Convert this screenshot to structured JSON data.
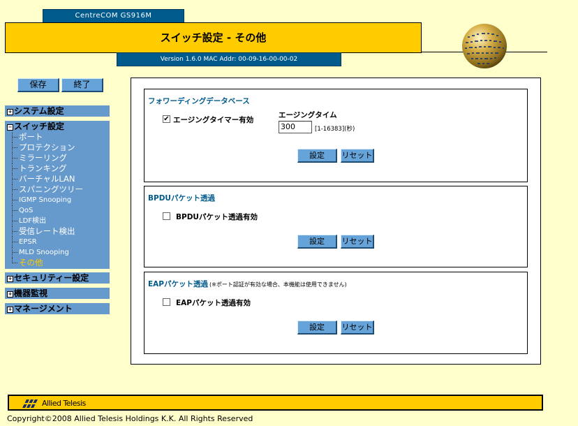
{
  "header": {
    "product": "CentreCOM GS916M",
    "title": "スイッチ設定 - その他",
    "version": "Version 1.6.0 MAC Addr: 00-09-16-00-00-02"
  },
  "toolbar": {
    "save_label": "保存",
    "exit_label": "終了"
  },
  "sidebar": {
    "system": "システム設定",
    "switch": "スイッチ設定",
    "items": [
      "ポート",
      "プロテクション",
      "ミラーリング",
      "トランキング",
      "バーチャルLAN",
      "スパニングツリー",
      "IGMP Snooping",
      "QoS",
      "LDF検出",
      "受信レート検出",
      "EPSR",
      "MLD Snooping",
      "その他"
    ],
    "security": "セキュリティー設定",
    "monitor": "機器監視",
    "management": "マネージメント",
    "colors": {
      "nav_bg": "#6699cc",
      "active_item": "#ffcc00"
    }
  },
  "fdb": {
    "title": "フォワーディングデータベース",
    "aging_enabled_label": "エージングタイマー有効",
    "aging_enabled_checked": true,
    "aging_time_label": "エージングタイム",
    "aging_time_value": "300",
    "aging_time_range": "[1-16383](秒)",
    "set_label": "設定",
    "reset_label": "リセット"
  },
  "bpdu": {
    "title": "BPDUパケット透過",
    "enable_label": "BPDUパケット透過有効",
    "enable_checked": false,
    "set_label": "設定",
    "reset_label": "リセット"
  },
  "eap": {
    "title": "EAPパケット透過",
    "note": "(※ポート認証が有効な場合、本機能は使用できません)",
    "enable_label": "EAPパケット透過有効",
    "enable_checked": false,
    "set_label": "設定",
    "reset_label": "リセット"
  },
  "footer": {
    "brand": "Allied Telesis",
    "copyright": "Copyright©2008 Allied Telesis Holdings K.K. All Rights Reserved"
  },
  "colors": {
    "background": "#ffffcc",
    "brand_yellow": "#ffcc00",
    "brand_blue": "#005b8c",
    "button_blue": "#66a3d9"
  }
}
